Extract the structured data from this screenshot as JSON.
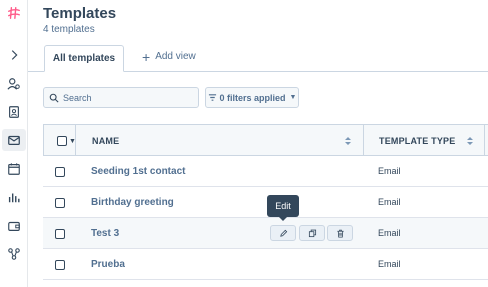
{
  "header": {
    "title": "Templates",
    "subtitle": "4 templates"
  },
  "tabs": {
    "active_label": "All templates",
    "add_view_label": "Add view"
  },
  "toolbar": {
    "search_placeholder": "Search",
    "filters_label": "0 filters applied"
  },
  "table": {
    "columns": [
      "NAME",
      "TEMPLATE TYPE"
    ],
    "rows": [
      {
        "name": "Seeding 1st contact",
        "type": "Email"
      },
      {
        "name": "Birthday greeting",
        "type": "Email"
      },
      {
        "name": "Test 3",
        "type": "Email"
      },
      {
        "name": "Prueba",
        "type": "Email"
      }
    ]
  },
  "tooltip": {
    "text": "Edit"
  },
  "colors": {
    "brand": "#ff5c8a",
    "text": "#33475b",
    "muted": "#516f90",
    "border": "#cbd6e2"
  },
  "icons": {
    "sidebar": [
      "logo-icon",
      "chevron-right-icon",
      "contacts-icon",
      "address-book-icon",
      "email-icon",
      "calendar-icon",
      "reports-icon",
      "wallet-icon",
      "workflow-icon"
    ],
    "row_actions": [
      "pencil-icon",
      "copy-icon",
      "trash-icon"
    ]
  }
}
